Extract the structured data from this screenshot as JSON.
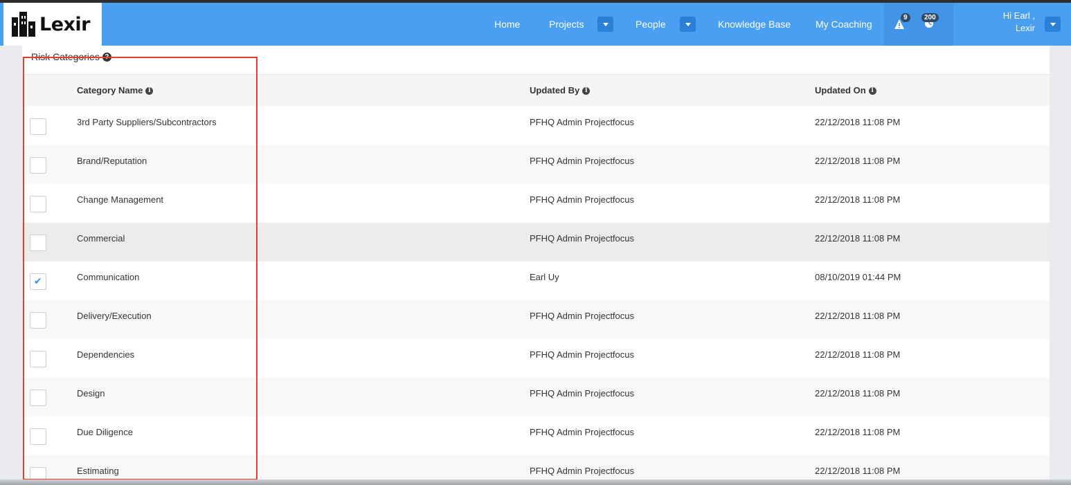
{
  "brand": {
    "name": "Lexir"
  },
  "nav": {
    "home": "Home",
    "projects": "Projects",
    "people": "People",
    "knowledge_base": "Knowledge Base",
    "my_coaching": "My Coaching",
    "alerts_count": "9",
    "notifications_count": "200",
    "user_greeting": "Hi Earl ,",
    "user_company": "Lexir"
  },
  "panel": {
    "title": "Risk Categories",
    "columns": {
      "category_name": "Category Name",
      "updated_by": "Updated By",
      "updated_on": "Updated On"
    },
    "rows": [
      {
        "name": "3rd Party Suppliers/Subcontractors",
        "updated_by": "PFHQ Admin Projectfocus",
        "updated_on": "22/12/2018 11:08 PM",
        "checked": false
      },
      {
        "name": "Brand/Reputation",
        "updated_by": "PFHQ Admin Projectfocus",
        "updated_on": "22/12/2018 11:08 PM",
        "checked": false
      },
      {
        "name": "Change Management",
        "updated_by": "PFHQ Admin Projectfocus",
        "updated_on": "22/12/2018 11:08 PM",
        "checked": false
      },
      {
        "name": "Commercial",
        "updated_by": "PFHQ Admin Projectfocus",
        "updated_on": "22/12/2018 11:08 PM",
        "checked": false
      },
      {
        "name": "Communication",
        "updated_by": "Earl Uy",
        "updated_on": "08/10/2019 01:44 PM",
        "checked": true
      },
      {
        "name": "Delivery/Execution",
        "updated_by": "PFHQ Admin Projectfocus",
        "updated_on": "22/12/2018 11:08 PM",
        "checked": false
      },
      {
        "name": "Dependencies",
        "updated_by": "PFHQ Admin Projectfocus",
        "updated_on": "22/12/2018 11:08 PM",
        "checked": false
      },
      {
        "name": "Design",
        "updated_by": "PFHQ Admin Projectfocus",
        "updated_on": "22/12/2018 11:08 PM",
        "checked": false
      },
      {
        "name": "Due Diligence",
        "updated_by": "PFHQ Admin Projectfocus",
        "updated_on": "22/12/2018 11:08 PM",
        "checked": false
      },
      {
        "name": "Estimating",
        "updated_by": "PFHQ Admin Projectfocus",
        "updated_on": "22/12/2018 11:08 PM",
        "checked": false
      }
    ]
  },
  "icons": {
    "info": "info-icon",
    "help": "help-icon",
    "alert": "warning-icon",
    "globe": "globe-icon"
  },
  "colors": {
    "navbar": "#4a9ff0",
    "accent": "#3b8ff0",
    "highlight_box": "#e0402a"
  }
}
